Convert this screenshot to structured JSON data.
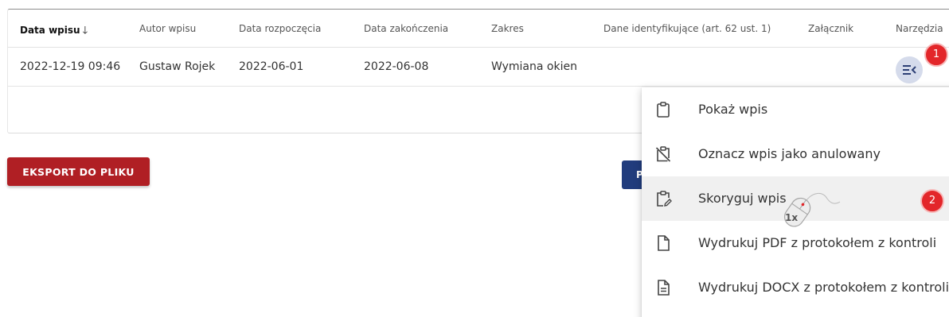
{
  "table": {
    "headers": [
      {
        "label": "Data wpisu",
        "sorted": true
      },
      {
        "label": "Autor wpisu"
      },
      {
        "label": "Data rozpoczęcia"
      },
      {
        "label": "Data zakończenia"
      },
      {
        "label": "Zakres"
      },
      {
        "label": "Dane identyfikujące (art. 62 ust. 1)"
      },
      {
        "label": "Załącznik"
      },
      {
        "label": "Narzędzia"
      }
    ],
    "sort_icon": "arrow-down-icon",
    "rows": [
      {
        "date": "2022-12-19 09:46",
        "author": "Gustaw Rojek",
        "start": "2022-06-01",
        "end": "2022-06-08",
        "scope": "Wymiana okien",
        "identifying_data": "",
        "attachment": ""
      }
    ]
  },
  "tools_icon": "menu-open-icon",
  "export_button": "EKSPORT DO PLIKU",
  "partial_button": "P",
  "menu": {
    "items": [
      {
        "label": "Pokaż wpis",
        "icon": "clipboard-icon"
      },
      {
        "label": "Oznacz wpis jako anulowany",
        "icon": "clipboard-off-icon"
      },
      {
        "label": "Skoryguj wpis",
        "icon": "clipboard-edit-icon",
        "hover": true
      },
      {
        "label": "Wydrukuj PDF z protokołem z kontroli",
        "icon": "file-icon"
      },
      {
        "label": "Wydrukuj DOCX z protokołem z kontroli",
        "icon": "file-text-icon"
      }
    ]
  },
  "annotations": {
    "step1": "1",
    "step2": "2",
    "click_count": "1x"
  },
  "colors": {
    "export_button": "#b01f24",
    "badge": "#e3262a",
    "tools_button": "#d5dbeb",
    "primary_button": "#213c7d"
  }
}
